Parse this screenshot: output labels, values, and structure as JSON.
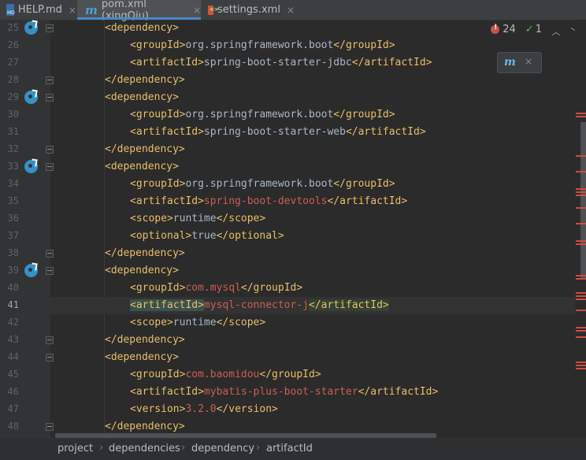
{
  "tabs": [
    {
      "label": "HELP.md",
      "icon": "markdown-file-icon",
      "active": false
    },
    {
      "label": "pom.xml (xingQiu)",
      "icon": "maven-m-icon",
      "active": true
    },
    {
      "label": "settings.xml",
      "icon": "xml-file-icon",
      "active": false
    }
  ],
  "close_glyph": "×",
  "inspections": {
    "errors": "24",
    "ok": "1"
  },
  "gutter": {
    "line_numbers": [
      "25",
      "26",
      "27",
      "28",
      "29",
      "30",
      "31",
      "32",
      "33",
      "34",
      "35",
      "36",
      "37",
      "38",
      "39",
      "40",
      "41",
      "42",
      "43",
      "44",
      "45",
      "46",
      "47",
      "48"
    ],
    "current_line": "41"
  },
  "code": {
    "lines": [
      "<dependency>",
      "<groupId>org.springframework.boot</groupId>",
      "<artifactId>spring-boot-starter-jdbc</artifactId>",
      "</dependency>",
      "<dependency>",
      "<groupId>org.springframework.boot</groupId>",
      "<artifactId>spring-boot-starter-web</artifactId>",
      "</dependency>",
      "<dependency>",
      "<groupId>org.springframework.boot</groupId>",
      "<artifactId>spring-boot-devtools</artifactId>",
      "<scope>runtime</scope>",
      "<optional>true</optional>",
      "</dependency>",
      "<dependency>",
      "<groupId>com.mysql</groupId>",
      "<artifactId>mysql-connector-j</artifactId>",
      "<scope>runtime</scope>",
      "</dependency>",
      "<dependency>",
      "<groupId>com.baomidou</groupId>",
      "<artifactId>mybatis-plus-boot-starter</artifactId>",
      "<version>3.2.0</version>",
      "</dependency>"
    ]
  },
  "breadcrumb": [
    "project",
    "dependencies",
    "dependency",
    "artifactId"
  ],
  "colors": {
    "tag": "#e8bf6a",
    "text": "#a9b7c6",
    "unresolved": "#cc5d56",
    "accent": "#4a88c7",
    "error": "#cf4a44"
  }
}
